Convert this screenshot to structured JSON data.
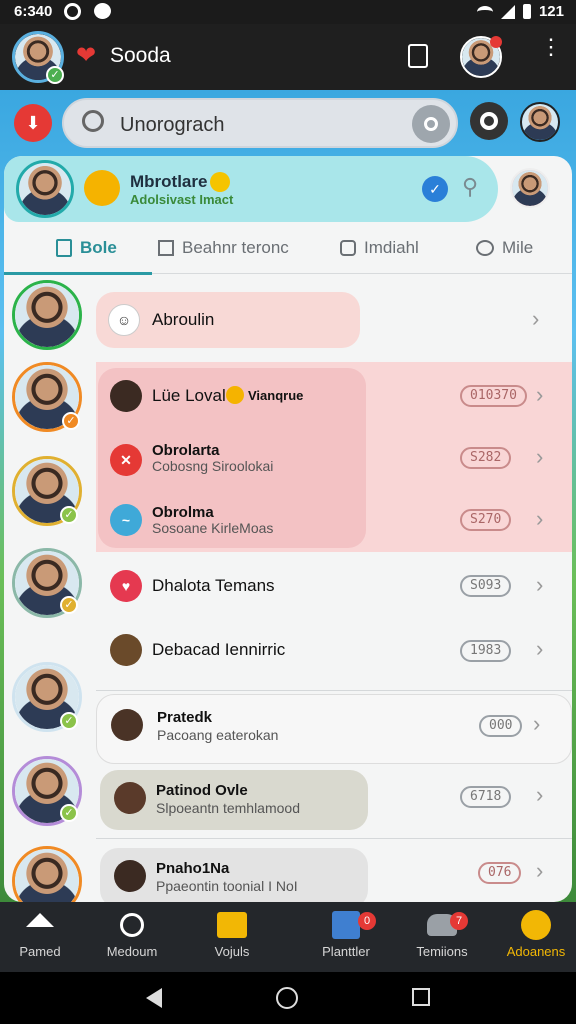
{
  "status_bar": {
    "time": "6:340",
    "battery": "121"
  },
  "app_bar": {
    "title": "Sooda"
  },
  "search": {
    "placeholder": "Unorograch"
  },
  "hero": {
    "name": "Mbrotlare",
    "subtitle": "Adolsivast Imact"
  },
  "tabs": [
    {
      "label": "Bole"
    },
    {
      "label": "Beahnr teronc"
    },
    {
      "label": "Imdiahl"
    },
    {
      "label": "Mile"
    }
  ],
  "rows": [
    {
      "title": "Abroulin",
      "sub": "",
      "chip": ""
    },
    {
      "title": "Lüe Loval",
      "extra": "Vianqrue",
      "chip": "010370"
    },
    {
      "title": "Obrolarta",
      "sub": "Cobosng Siroolokai",
      "chip": "S282"
    },
    {
      "title": "Obrolma",
      "sub": "Sosoane KirleMoas",
      "chip": "S270"
    },
    {
      "title": "Dhalota Temans",
      "sub": "",
      "chip": "S093"
    },
    {
      "title": "Debacad Iennirric",
      "sub": "",
      "chip": "1983"
    },
    {
      "title": "Pratedk",
      "sub": "Pacoang eaterokan",
      "chip": "000"
    },
    {
      "title": "Patinod Ovle",
      "sub": "Slpoeantn temhlamood",
      "chip": "6718"
    },
    {
      "title": "Pnaho1Na",
      "sub": "Ppaeontin toonial I NoI",
      "chip": "076"
    }
  ],
  "bottom_nav": [
    {
      "label": "Pamed"
    },
    {
      "label": "Medoum"
    },
    {
      "label": "Vojuls"
    },
    {
      "label": "Planttler",
      "badge": "0"
    },
    {
      "label": "Temiions",
      "badge": "7"
    },
    {
      "label": "Adoanens"
    }
  ],
  "colors": {
    "accent": "#2a9aa4",
    "active_nav": "#f2b705",
    "hero_bg": "#a9e6ea",
    "highlight_bg": "#f6cfd0"
  }
}
